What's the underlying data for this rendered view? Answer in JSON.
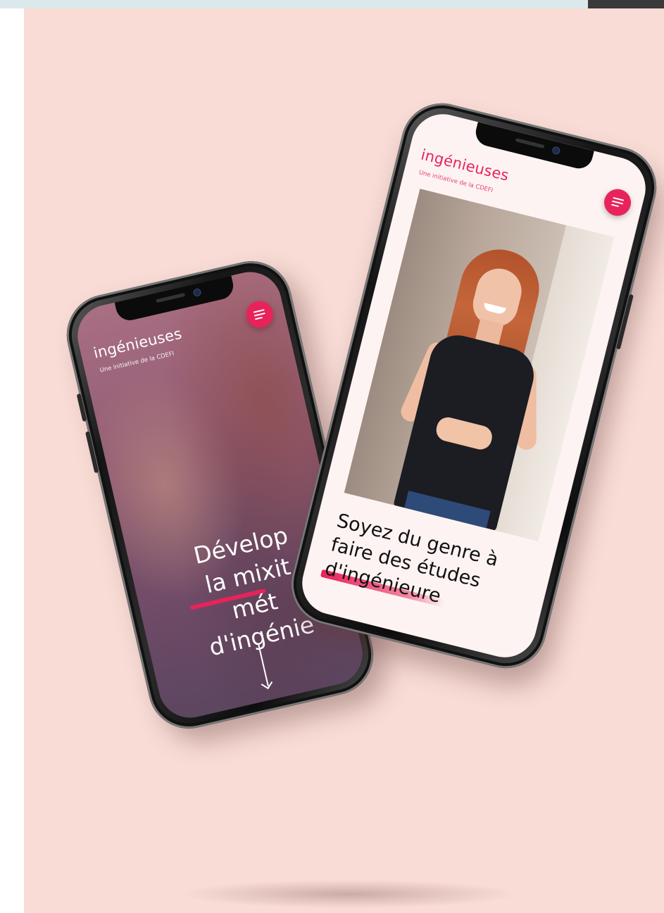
{
  "colors": {
    "background": "#f9dcd6",
    "accent": "#e8235a",
    "phone_frame": "#151515",
    "right_screen_bg": "#fdf3f2"
  },
  "phone_left": {
    "brand": "ingénieuses",
    "brand_subtitle": "Une initiative de la CDEFI",
    "menu_icon": "hamburger-menu-icon",
    "hero_lines": [
      "Dévelop",
      "la mixit",
      "mét",
      "d'ingénie"
    ],
    "scroll_icon": "arrow-down-icon"
  },
  "phone_right": {
    "brand": "ingénieuses",
    "brand_subtitle": "Une initiative de la CDEFI",
    "menu_icon": "hamburger-menu-icon",
    "tagline_line1": "Soyez du genre à",
    "tagline_line2": "faire des études",
    "tagline_highlight": "d'ingénieure"
  }
}
